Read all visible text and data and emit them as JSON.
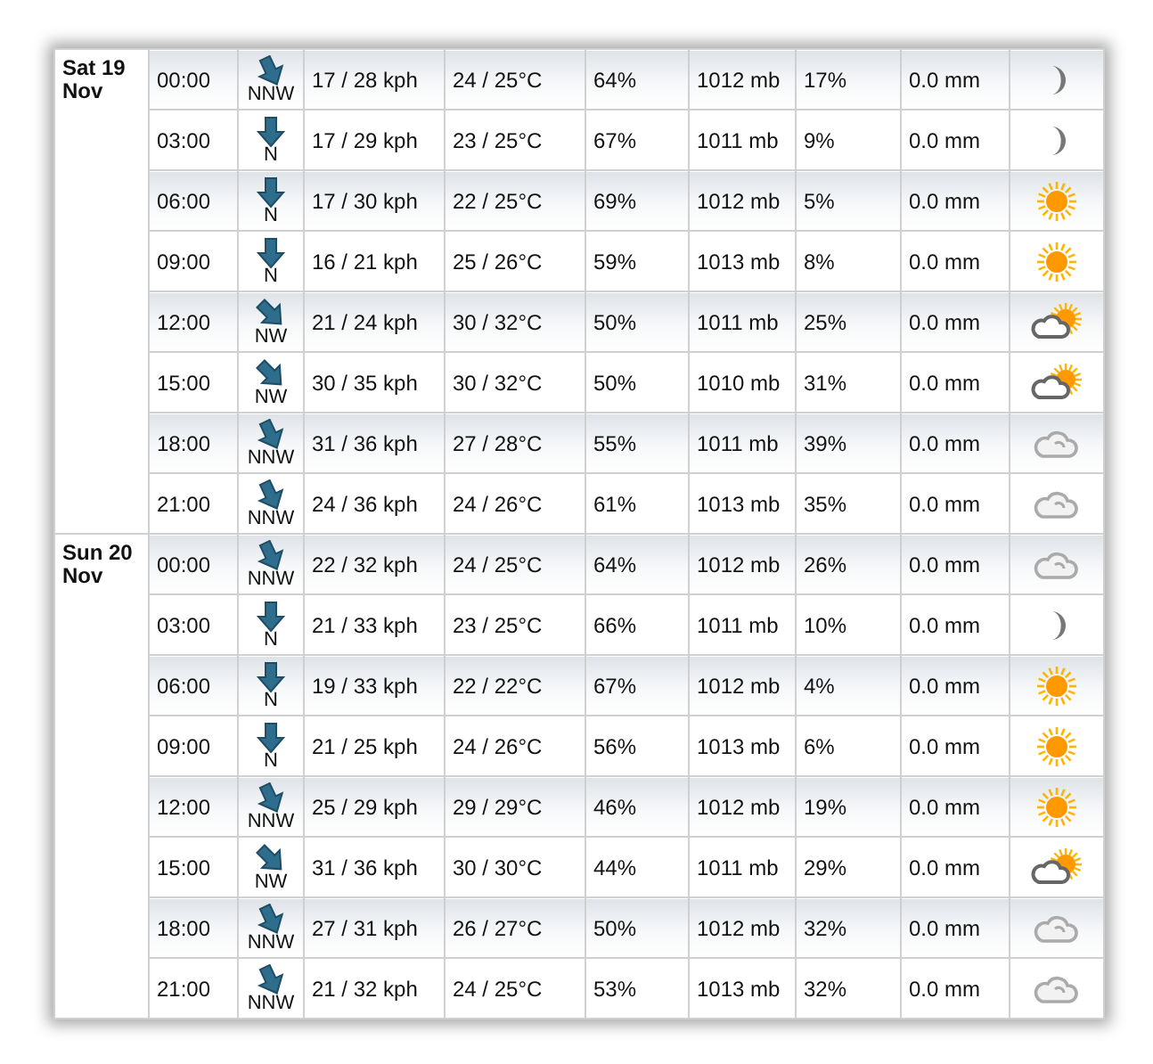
{
  "days": [
    {
      "label": "Sat 19 Nov",
      "rows": [
        {
          "time": "00:00",
          "dir": {
            "label": "NNW",
            "kind": "slight"
          },
          "wind": "17 / 28 kph",
          "temp": "24 / 25°C",
          "humidity": "64%",
          "pressure": "1012 mb",
          "cloud": "17%",
          "precip": "0.0 mm",
          "weather": {
            "kind": "moon"
          }
        },
        {
          "time": "03:00",
          "dir": {
            "label": "N",
            "kind": "down"
          },
          "wind": "17 / 29 kph",
          "temp": "23 / 25°C",
          "humidity": "67%",
          "pressure": "1011 mb",
          "cloud": "9%",
          "precip": "0.0 mm",
          "weather": {
            "kind": "moon"
          }
        },
        {
          "time": "06:00",
          "dir": {
            "label": "N",
            "kind": "down"
          },
          "wind": "17 / 30 kph",
          "temp": "22 / 25°C",
          "humidity": "69%",
          "pressure": "1012 mb",
          "cloud": "5%",
          "precip": "0.0 mm",
          "weather": {
            "kind": "sun"
          }
        },
        {
          "time": "09:00",
          "dir": {
            "label": "N",
            "kind": "down"
          },
          "wind": "16 / 21 kph",
          "temp": "25 / 26°C",
          "humidity": "59%",
          "pressure": "1013 mb",
          "cloud": "8%",
          "precip": "0.0 mm",
          "weather": {
            "kind": "sun"
          }
        },
        {
          "time": "12:00",
          "dir": {
            "label": "NW",
            "kind": "diagonal"
          },
          "wind": "21 / 24 kph",
          "temp": "30 / 32°C",
          "humidity": "50%",
          "pressure": "1011 mb",
          "cloud": "25%",
          "precip": "0.0 mm",
          "weather": {
            "kind": "partly"
          }
        },
        {
          "time": "15:00",
          "dir": {
            "label": "NW",
            "kind": "diagonal"
          },
          "wind": "30 / 35 kph",
          "temp": "30 / 32°C",
          "humidity": "50%",
          "pressure": "1010 mb",
          "cloud": "31%",
          "precip": "0.0 mm",
          "weather": {
            "kind": "partly"
          }
        },
        {
          "time": "18:00",
          "dir": {
            "label": "NNW",
            "kind": "slight"
          },
          "wind": "31 / 36 kph",
          "temp": "27 / 28°C",
          "humidity": "55%",
          "pressure": "1011 mb",
          "cloud": "39%",
          "precip": "0.0 mm",
          "weather": {
            "kind": "cloudy"
          }
        },
        {
          "time": "21:00",
          "dir": {
            "label": "NNW",
            "kind": "slight"
          },
          "wind": "24 / 36 kph",
          "temp": "24 / 26°C",
          "humidity": "61%",
          "pressure": "1013 mb",
          "cloud": "35%",
          "precip": "0.0 mm",
          "weather": {
            "kind": "cloudy"
          }
        }
      ]
    },
    {
      "label": "Sun 20 Nov",
      "rows": [
        {
          "time": "00:00",
          "dir": {
            "label": "NNW",
            "kind": "slight"
          },
          "wind": "22 / 32 kph",
          "temp": "24 / 25°C",
          "humidity": "64%",
          "pressure": "1012 mb",
          "cloud": "26%",
          "precip": "0.0 mm",
          "weather": {
            "kind": "cloudy"
          }
        },
        {
          "time": "03:00",
          "dir": {
            "label": "N",
            "kind": "down"
          },
          "wind": "21 / 33 kph",
          "temp": "23 / 25°C",
          "humidity": "66%",
          "pressure": "1011 mb",
          "cloud": "10%",
          "precip": "0.0 mm",
          "weather": {
            "kind": "moon"
          }
        },
        {
          "time": "06:00",
          "dir": {
            "label": "N",
            "kind": "down"
          },
          "wind": "19 / 33 kph",
          "temp": "22 / 22°C",
          "humidity": "67%",
          "pressure": "1012 mb",
          "cloud": "4%",
          "precip": "0.0 mm",
          "weather": {
            "kind": "sun"
          }
        },
        {
          "time": "09:00",
          "dir": {
            "label": "N",
            "kind": "down"
          },
          "wind": "21 / 25 kph",
          "temp": "24 / 26°C",
          "humidity": "56%",
          "pressure": "1013 mb",
          "cloud": "6%",
          "precip": "0.0 mm",
          "weather": {
            "kind": "sun"
          }
        },
        {
          "time": "12:00",
          "dir": {
            "label": "NNW",
            "kind": "slight"
          },
          "wind": "25 / 29 kph",
          "temp": "29 / 29°C",
          "humidity": "46%",
          "pressure": "1012 mb",
          "cloud": "19%",
          "precip": "0.0 mm",
          "weather": {
            "kind": "sun"
          }
        },
        {
          "time": "15:00",
          "dir": {
            "label": "NW",
            "kind": "diagonal"
          },
          "wind": "31 / 36 kph",
          "temp": "30 / 30°C",
          "humidity": "44%",
          "pressure": "1011 mb",
          "cloud": "29%",
          "precip": "0.0 mm",
          "weather": {
            "kind": "partly"
          }
        },
        {
          "time": "18:00",
          "dir": {
            "label": "NNW",
            "kind": "slight"
          },
          "wind": "27 / 31 kph",
          "temp": "26 / 27°C",
          "humidity": "50%",
          "pressure": "1012 mb",
          "cloud": "32%",
          "precip": "0.0 mm",
          "weather": {
            "kind": "cloudy"
          }
        },
        {
          "time": "21:00",
          "dir": {
            "label": "NNW",
            "kind": "slight"
          },
          "wind": "21 / 32 kph",
          "temp": "24 / 25°C",
          "humidity": "53%",
          "pressure": "1013 mb",
          "cloud": "32%",
          "precip": "0.0 mm",
          "weather": {
            "kind": "cloudy"
          }
        }
      ]
    }
  ]
}
